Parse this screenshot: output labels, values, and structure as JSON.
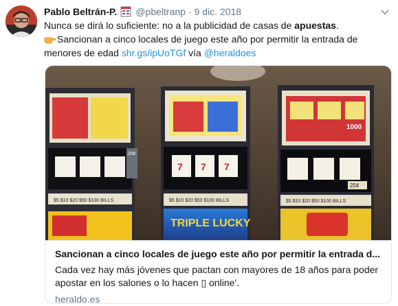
{
  "tweet": {
    "display_name": "Pablo Beltrán-P.",
    "handle": "@pbeltranp",
    "separator": "·",
    "date": "9 dic. 2018",
    "line1_pre": "Nunca se dirá lo suficiente: no a la publicidad de casas de ",
    "line1_bold": "apuestas",
    "line1_post": ".",
    "line2_text": "Sancionan a cinco locales de juego este año por permitir la entrada de menores de edad ",
    "short_link": "shr.gs/ipUoTGf",
    "via_text": " vía ",
    "mention": "@heraldoes"
  },
  "card": {
    "title": "Sancionan a cinco locales de juego este año por permitir la entrada d...",
    "description": "Cada vez hay más jóvenes que pactan con mayores de 18 años para poder apostar en los salones o lo hacen ▯ online'.",
    "domain": "heraldo.es",
    "image_text": {
      "brand": "TRIPLE LUCKY",
      "machine1_pay": "$5 $10 $20 $50 $100 BILLS",
      "machine2_pay": "$5 $10 $20 $50 $100 BILLS",
      "machine3_pay": "$5 $10 $20 $50 $100 BILLS",
      "num_a": "25¢",
      "num_b": "1000",
      "num_c": "25¢"
    }
  },
  "colors": {
    "link": "#1b95e0",
    "muted": "#657786",
    "text": "#14171a",
    "border": "#e1e8ed"
  }
}
